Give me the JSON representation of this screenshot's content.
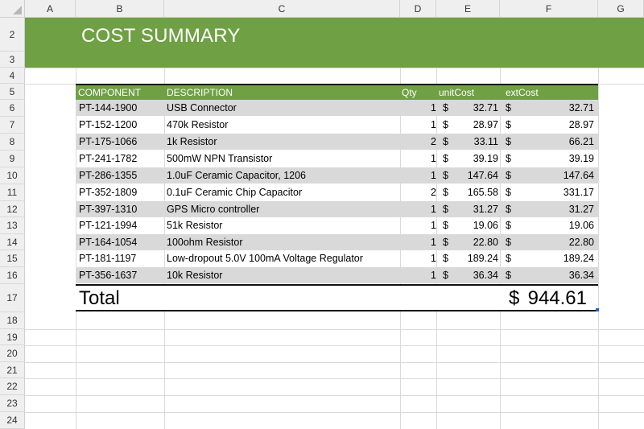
{
  "columns": [
    "A",
    "B",
    "C",
    "D",
    "E",
    "F",
    "G"
  ],
  "rows": [
    "2",
    "3",
    "4",
    "5",
    "6",
    "7",
    "8",
    "9",
    "10",
    "11",
    "12",
    "13",
    "14",
    "15",
    "16",
    "17",
    "18",
    "19",
    "20",
    "21",
    "22",
    "23",
    "24"
  ],
  "title": "COST SUMMARY",
  "headers": {
    "component": "COMPONENT",
    "description": "DESCRIPTION",
    "qty": "Qty",
    "unit_cost": "unitCost",
    "ext_cost": "extCost"
  },
  "items": [
    {
      "component": "PT-144-1900",
      "description": "USB Connector",
      "qty": "1",
      "currency": "$",
      "unit_cost": "32.71",
      "ext_cost": "32.71"
    },
    {
      "component": "PT-152-1200",
      "description": "470k Resistor",
      "qty": "1",
      "currency": "$",
      "unit_cost": "28.97",
      "ext_cost": "28.97"
    },
    {
      "component": "PT-175-1066",
      "description": "1k Resistor",
      "qty": "2",
      "currency": "$",
      "unit_cost": "33.11",
      "ext_cost": "66.21"
    },
    {
      "component": "PT-241-1782",
      "description": "500mW NPN Transistor",
      "qty": "1",
      "currency": "$",
      "unit_cost": "39.19",
      "ext_cost": "39.19"
    },
    {
      "component": "PT-286-1355",
      "description": "1.0uF Ceramic Capacitor, 1206",
      "qty": "1",
      "currency": "$",
      "unit_cost": "147.64",
      "ext_cost": "147.64"
    },
    {
      "component": "PT-352-1809",
      "description": "0.1uF Ceramic Chip Capacitor",
      "qty": "2",
      "currency": "$",
      "unit_cost": "165.58",
      "ext_cost": "331.17"
    },
    {
      "component": "PT-397-1310",
      "description": "GPS Micro controller",
      "qty": "1",
      "currency": "$",
      "unit_cost": "31.27",
      "ext_cost": "31.27"
    },
    {
      "component": "PT-121-1994",
      "description": "51k Resistor",
      "qty": "1",
      "currency": "$",
      "unit_cost": "19.06",
      "ext_cost": "19.06"
    },
    {
      "component": "PT-164-1054",
      "description": "100ohm Resistor",
      "qty": "1",
      "currency": "$",
      "unit_cost": "22.80",
      "ext_cost": "22.80"
    },
    {
      "component": "PT-181-1197",
      "description": "Low-dropout 5.0V 100mA Voltage Regulator",
      "qty": "1",
      "currency": "$",
      "unit_cost": "189.24",
      "ext_cost": "189.24"
    },
    {
      "component": "PT-356-1637",
      "description": "10k Resistor",
      "qty": "1",
      "currency": "$",
      "unit_cost": "36.34",
      "ext_cost": "36.34"
    }
  ],
  "total": {
    "label": "Total",
    "currency": "$",
    "value": "944.61"
  },
  "colors": {
    "accent_green": "#6fa043",
    "row_shade": "#d9d9d9",
    "header_bg": "#efefef"
  }
}
